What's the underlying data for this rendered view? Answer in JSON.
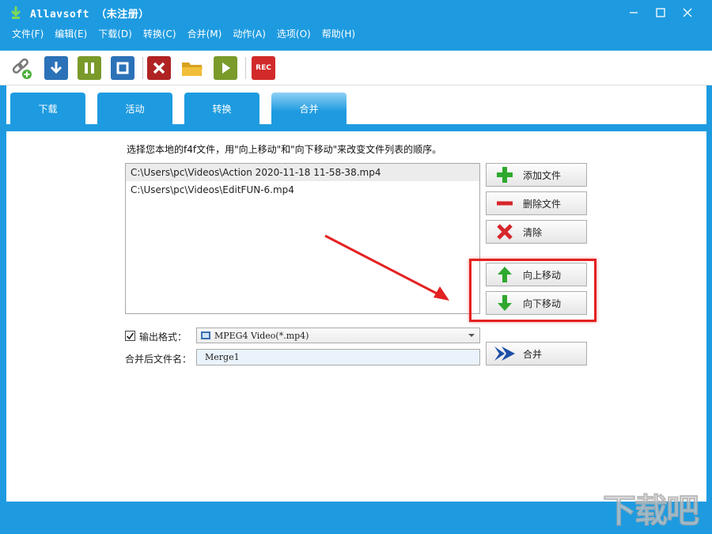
{
  "window": {
    "title": "Allavsoft  （未注册）"
  },
  "menu": {
    "items": [
      "文件(F)",
      "编辑(E)",
      "下载(D)",
      "转换(C)",
      "合并(M)",
      "动作(A)",
      "选项(O)",
      "帮助(H)"
    ]
  },
  "toolbar": {
    "rec_label": "REC"
  },
  "tabs": [
    {
      "label": "下载",
      "active": false
    },
    {
      "label": "活动",
      "active": false
    },
    {
      "label": "转换",
      "active": false
    },
    {
      "label": "合并",
      "active": true
    }
  ],
  "merge": {
    "instruction": "选择您本地的f4f文件，用\"向上移动\"和\"向下移动\"来改变文件列表的顺序。",
    "files": [
      "C:\\Users\\pc\\Videos\\Action 2020-11-18 11-58-38.mp4",
      "C:\\Users\\pc\\Videos\\EditFUN-6.mp4"
    ],
    "buttons": {
      "add": "添加文件",
      "delete": "删除文件",
      "clear": "清除",
      "move_up": "向上移动",
      "move_down": "向下移动",
      "merge": "合并"
    },
    "output_format_label": "输出格式：",
    "output_format_checked": true,
    "output_format_value": "MPEG4 Video(*.mp4)",
    "filename_label": "合并后文件名：",
    "filename_value": "Merge1"
  },
  "colors": {
    "accent": "#1e9be0",
    "highlight": "#e32222",
    "add_green": "#2fa82f",
    "delete_red": "#d6262b",
    "merge_blue": "#1c4fa6"
  },
  "watermark": "下载吧"
}
